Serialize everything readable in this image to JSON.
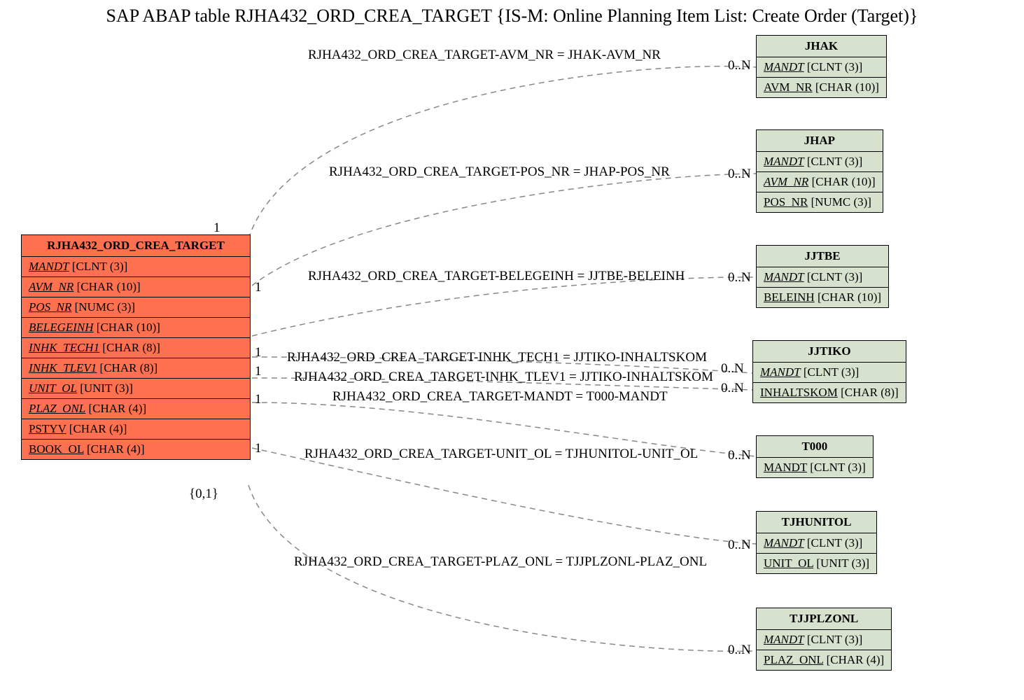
{
  "title": "SAP ABAP table RJHA432_ORD_CREA_TARGET {IS-M: Online Planning Item List: Create Order (Target)}",
  "main": {
    "name": "RJHA432_ORD_CREA_TARGET",
    "fields": [
      {
        "name": "MANDT",
        "type": "[CLNT (3)]",
        "italic": true
      },
      {
        "name": "AVM_NR",
        "type": "[CHAR (10)]",
        "italic": true
      },
      {
        "name": "POS_NR",
        "type": "[NUMC (3)]",
        "italic": true
      },
      {
        "name": "BELEGEINH",
        "type": "[CHAR (10)]",
        "italic": true
      },
      {
        "name": "INHK_TECH1",
        "type": "[CHAR (8)]",
        "italic": true
      },
      {
        "name": "INHK_TLEV1",
        "type": "[CHAR (8)]",
        "italic": true
      },
      {
        "name": "UNIT_OL",
        "type": "[UNIT (3)]",
        "italic": true
      },
      {
        "name": "PLAZ_ONL",
        "type": "[CHAR (4)]",
        "italic": true
      },
      {
        "name": "PSTYV",
        "type": "[CHAR (4)]",
        "italic": false
      },
      {
        "name": "BOOK_OL",
        "type": "[CHAR (4)]",
        "italic": false
      }
    ]
  },
  "related": [
    {
      "name": "JHAK",
      "fields": [
        {
          "name": "MANDT",
          "type": "[CLNT (3)]",
          "italic": true
        },
        {
          "name": "AVM_NR",
          "type": "[CHAR (10)]",
          "italic": false
        }
      ]
    },
    {
      "name": "JHAP",
      "fields": [
        {
          "name": "MANDT",
          "type": "[CLNT (3)]",
          "italic": true
        },
        {
          "name": "AVM_NR",
          "type": "[CHAR (10)]",
          "italic": true
        },
        {
          "name": "POS_NR",
          "type": "[NUMC (3)]",
          "italic": false
        }
      ]
    },
    {
      "name": "JJTBE",
      "fields": [
        {
          "name": "MANDT",
          "type": "[CLNT (3)]",
          "italic": true
        },
        {
          "name": "BELEINH",
          "type": "[CHAR (10)]",
          "italic": false
        }
      ]
    },
    {
      "name": "JJTIKO",
      "fields": [
        {
          "name": "MANDT",
          "type": "[CLNT (3)]",
          "italic": true
        },
        {
          "name": "INHALTSKOM",
          "type": "[CHAR (8)]",
          "italic": false
        }
      ]
    },
    {
      "name": "T000",
      "fields": [
        {
          "name": "MANDT",
          "type": "[CLNT (3)]",
          "italic": false
        }
      ]
    },
    {
      "name": "TJHUNITOL",
      "fields": [
        {
          "name": "MANDT",
          "type": "[CLNT (3)]",
          "italic": true
        },
        {
          "name": "UNIT_OL",
          "type": "[UNIT (3)]",
          "italic": false
        }
      ]
    },
    {
      "name": "TJJPLZONL",
      "fields": [
        {
          "name": "MANDT",
          "type": "[CLNT (3)]",
          "italic": true
        },
        {
          "name": "PLAZ_ONL",
          "type": "[CHAR (4)]",
          "italic": false
        }
      ]
    }
  ],
  "joins": [
    "RJHA432_ORD_CREA_TARGET-AVM_NR = JHAK-AVM_NR",
    "RJHA432_ORD_CREA_TARGET-POS_NR = JHAP-POS_NR",
    "RJHA432_ORD_CREA_TARGET-BELEGEINH = JJTBE-BELEINH",
    "RJHA432_ORD_CREA_TARGET-INHK_TECH1 = JJTIKO-INHALTSKOM",
    "RJHA432_ORD_CREA_TARGET-INHK_TLEV1 = JJTIKO-INHALTSKOM",
    "RJHA432_ORD_CREA_TARGET-MANDT = T000-MANDT",
    "RJHA432_ORD_CREA_TARGET-UNIT_OL = TJHUNITOL-UNIT_OL",
    "RJHA432_ORD_CREA_TARGET-PLAZ_ONL = TJJPLZONL-PLAZ_ONL"
  ],
  "cards": {
    "left": [
      "1",
      "1",
      "1",
      "1",
      "1",
      "1",
      "1",
      "{0,1}"
    ],
    "right": [
      "0..N",
      "0..N",
      "0..N",
      "0..N",
      "0..N",
      "0..N",
      "0..N",
      "0..N"
    ]
  }
}
